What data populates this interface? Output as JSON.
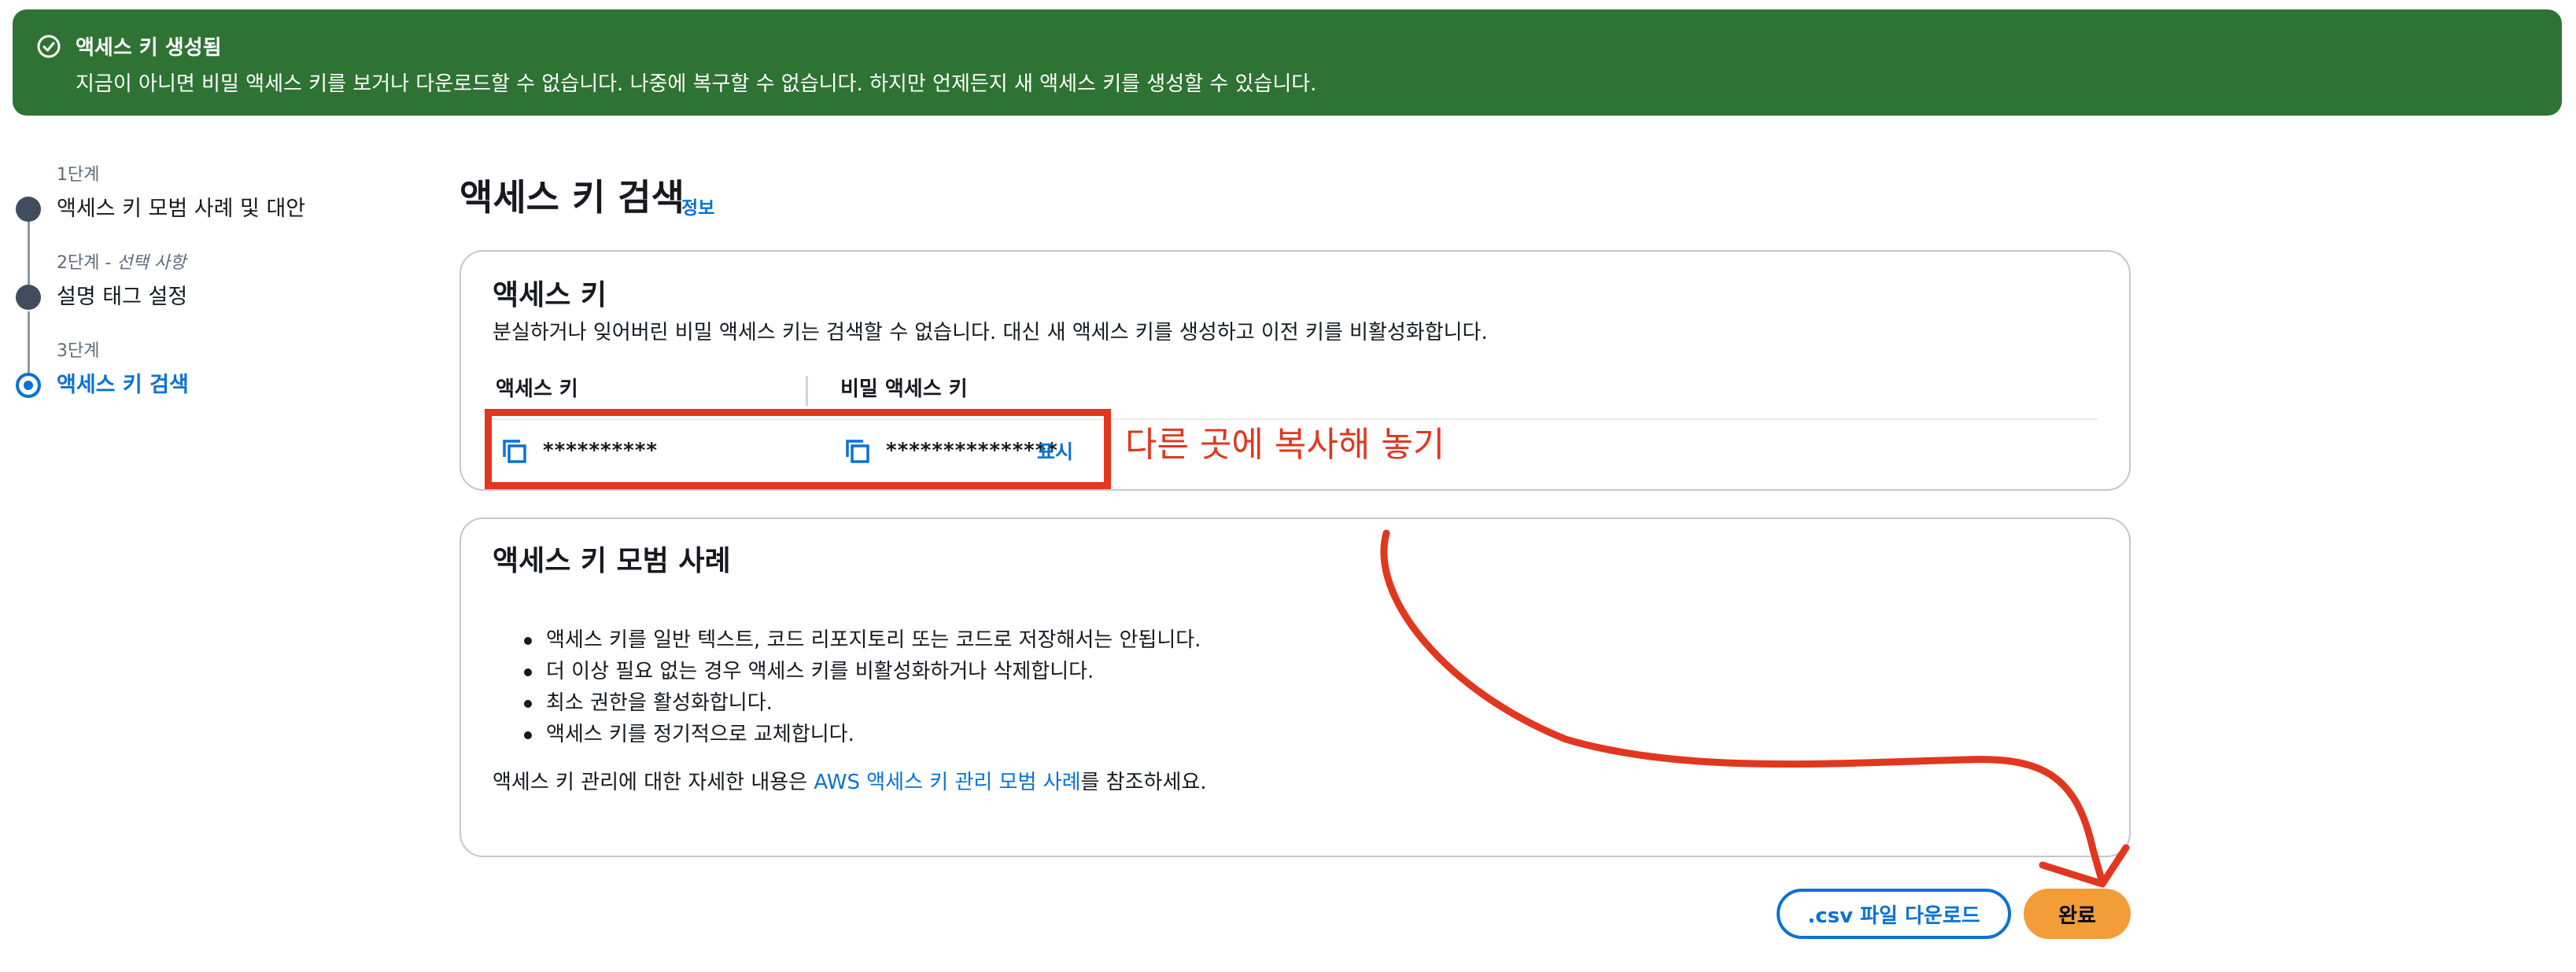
{
  "flash": {
    "title": "액세스 키 생성됨",
    "message": "지금이 아니면 비밀 액세스 키를 보거나 다운로드할 수 없습니다. 나중에 복구할 수 없습니다. 하지만 언제든지 새 액세스 키를 생성할 수 있습니다.",
    "icon": "check-circle-icon",
    "color": "#2e7333"
  },
  "steps": [
    {
      "number": "1단계",
      "label": "액세스 키 모범 사례 및 대안"
    },
    {
      "number": "2단계 - ",
      "optional": "선택 사항",
      "label": "설명 태그 설정"
    },
    {
      "number": "3단계",
      "label": "액세스 키 검색",
      "active": true
    }
  ],
  "page": {
    "title": "액세스 키 검색",
    "info_link": "정보"
  },
  "access_key_card": {
    "title": "액세스 키",
    "description": "분실하거나 잊어버린 비밀 액세스 키는 검색할 수 없습니다. 대신 새 액세스 키를 생성하고 이전 키를 비활성화합니다.",
    "columns": [
      "액세스 키",
      "비밀 액세스 키"
    ],
    "access_key_value": "**********",
    "secret_key_value": "***************",
    "show_link": "표시"
  },
  "annotation": {
    "note": "다른 곳에 복사해 놓기",
    "color": "#e1371f"
  },
  "best_practices_card": {
    "title": "액세스 키 모범 사례",
    "bullets": [
      "액세스 키를 일반 텍스트, 코드 리포지토리 또는 코드로 저장해서는 안됩니다.",
      "더 이상 필요 없는 경우 액세스 키를 비활성화하거나 삭제합니다.",
      "최소 권한을 활성화합니다.",
      "액세스 키를 정기적으로 교체합니다."
    ],
    "more_prefix": "액세스 키 관리에 대한 자세한 내용은 ",
    "more_link": "AWS 액세스 키 관리 모범 사례",
    "more_suffix": "를 참조하세요."
  },
  "buttons": {
    "download_csv": ".csv 파일 다운로드",
    "done": "완료"
  },
  "colors": {
    "link": "#0972d3",
    "primary_button": "#f29d38"
  }
}
